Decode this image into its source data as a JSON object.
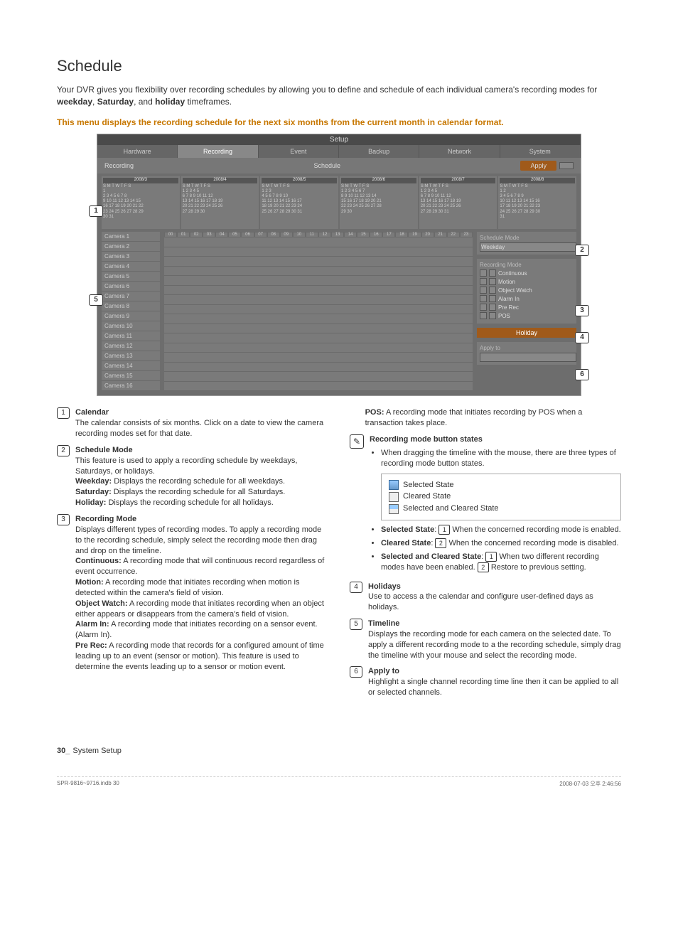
{
  "page": {
    "heading": "Schedule",
    "intro_pre": "Your DVR gives you flexibility over recording schedules by allowing you to define and schedule of each individual camera's recording modes for ",
    "intro_w": "weekday",
    "intro_s": "Saturday",
    "intro_h": "holiday",
    "intro_post": " timeframes.",
    "highlight": "This menu displays the recording schedule for the next six months from the current month in calendar format."
  },
  "shot": {
    "title": "Setup",
    "tabs": [
      "Hardware",
      "Recording",
      "Event",
      "Backup",
      "Network",
      "System"
    ],
    "active_tab": "Recording",
    "sub_left": "Recording",
    "sub_mid": "Schedule",
    "apply": "Apply",
    "cal_months": [
      "2008/3",
      "2008/4",
      "2008/5",
      "2008/6",
      "2008/7",
      "2008/8"
    ],
    "cal_days": "S M T W T F S",
    "cal_rows": [
      "            1",
      "2 3 4 5 6 7 8",
      "9 10 11 12 13 14 15",
      "16 17 18 19 20 21 22",
      "23 24 25 26 27 28 29",
      "30 31",
      "   1 2 3 4 5",
      "6 7 8 9 10 11 12",
      "13 14 15 16 17 18 19",
      "20 21 22 23 24 25 26",
      "27 28 29 30",
      "        1 2 3",
      "4 5 6 7 8 9 10",
      "11 12 13 14 15 16 17",
      "18 19 20 21 22 23 24",
      "25 26 27 28 29 30 31",
      "1 2 3 4 5 6 7",
      "8 9 10 11 12 13 14",
      "15 16 17 18 19 20 21",
      "22 23 24 25 26 27 28",
      "29 30",
      "   1 2 3 4 5",
      "6 7 8 9 10 11 12",
      "13 14 15 16 17 18 19",
      "20 21 22 23 24 25 26",
      "27 28 29 30 31",
      "          1 2",
      "3 4 5 6 7 8 9",
      "10 11 12 13 14 15 16",
      "17 18 19 20 21 22 23",
      "24 25 26 27 28 29 30",
      "31"
    ],
    "hours": [
      "00",
      "01",
      "02",
      "03",
      "04",
      "05",
      "06",
      "07",
      "08",
      "09",
      "10",
      "11",
      "12",
      "13",
      "14",
      "15",
      "16",
      "17",
      "18",
      "19",
      "20",
      "21",
      "22",
      "23"
    ],
    "cameras": [
      "Camera 1",
      "Camera 2",
      "Camera 3",
      "Camera 4",
      "Camera 5",
      "Camera 6",
      "Camera 7",
      "Camera 8",
      "Camera 9",
      "Camera 10",
      "Camera 11",
      "Camera 12",
      "Camera 13",
      "Camera 14",
      "Camera 15",
      "Camera 16"
    ],
    "panel": {
      "schedmode_hdr": "Schedule Mode",
      "schedmode_val": "Weekday",
      "recmode_hdr": "Recording Mode",
      "modes": [
        "Continuous",
        "Motion",
        "Object Watch",
        "Alarm In",
        "Pre Rec",
        "POS"
      ],
      "holiday": "Holiday",
      "applyto_hdr": "Apply to"
    }
  },
  "desc": {
    "d1_t": "Calendar",
    "d1_b": "The calendar consists of six months. Click on a date to view the camera recording modes set for that date.",
    "d2_t": "Schedule Mode",
    "d2_b": "This feature is used to apply a recording schedule by weekdays, Saturdays, or holidays.",
    "d2_wk_l": "Weekday:",
    "d2_wk": " Displays the recording schedule for all weekdays.",
    "d2_sa_l": "Saturday:",
    "d2_sa": " Displays the recording schedule for all Saturdays.",
    "d2_ho_l": "Holiday:",
    "d2_ho": " Displays the recording schedule for all holidays.",
    "d3_t": "Recording Mode",
    "d3_b": "Displays different types of recording modes. To apply a recording mode to the recording schedule, simply select the recording mode then drag and drop on the timeline.",
    "d3_co_l": "Continuous:",
    "d3_co": " A recording mode that will continuous record regardless of event occurrence.",
    "d3_mo_l": "Motion:",
    "d3_mo": " A recording mode that initiates recording when motion is detected within the camera's field of vision.",
    "d3_ow_l": "Object Watch:",
    "d3_ow": " A recording mode that initiates recording when an object either appears or disappears from the camera's field of vision.",
    "d3_ai_l": "Alarm In:",
    "d3_ai": " A recording mode that initiates recording on a sensor event. (Alarm In).",
    "d3_pr_l": "Pre Rec:",
    "d3_pr": " A recording mode that records for a configured amount of time leading up to an event (sensor or motion). This feature is used to determine the events leading up to a sensor or motion event.",
    "d3_po_l": "POS:",
    "d3_po": " A recording mode that initiates recording by POS when a transaction takes place.",
    "note_t": "Recording mode button states",
    "note_b": "When dragging the timeline with the mouse, there are three types of recording mode button states.",
    "st_sel": "Selected State",
    "st_clr": "Cleared State",
    "st_both": "Selected and Cleared State",
    "ss_l": "Selected State",
    "ss_t": " When the concerned recording mode is enabled.",
    "cs_l": "Cleared State",
    "cs_t": " When the concerned recording mode is disabled.",
    "sc_l": "Selected and Cleared State",
    "sc_t1": " When two different recording modes have been enabled. ",
    "sc_t2": " Restore to previous setting.",
    "d4_t": "Holidays",
    "d4_b": "Use to access a the calendar and configure user-defined days as holidays.",
    "d5_t": "Timeline",
    "d5_b": "Displays the recording mode for each camera on the selected date. To apply a different recording mode to a the recording schedule, simply drag the timeline with your mouse and select the recording mode.",
    "d6_t": "Apply to",
    "d6_b": "Highlight a single channel recording time line then it can be applied to all or selected channels."
  },
  "footer": {
    "page": "30_",
    "section": "System Setup",
    "file": "SPR-9816~9716.indb   30",
    "date": "2008-07-03   오후 2:46:56"
  }
}
